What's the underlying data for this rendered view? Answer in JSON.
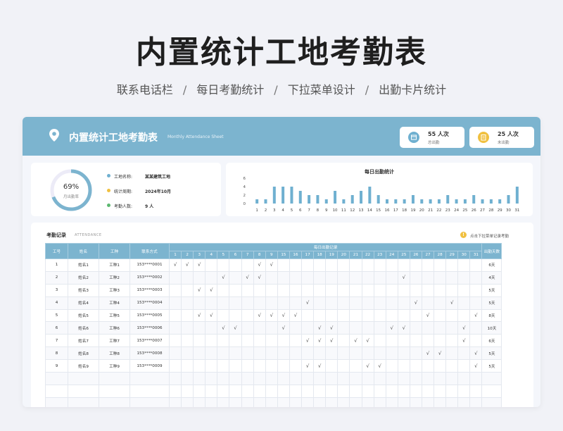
{
  "headline": "内置统计工地考勤表",
  "features": [
    "联系电话栏",
    "每日考勤统计",
    "下拉菜单设计",
    "出勤卡片统计"
  ],
  "feature_separator": "/",
  "sheet": {
    "title": "内置统计工地考勤表",
    "subtitle": "Monthly Attendance Sheet",
    "stats": [
      {
        "value": "55 人次",
        "label": "总出勤",
        "icon": "calendar-icon",
        "color": "#6fb0d0"
      },
      {
        "value": "25 人次",
        "label": "未出勤",
        "icon": "clipboard-icon",
        "color": "#f0c040"
      }
    ]
  },
  "summary": {
    "rate_value": "69%",
    "rate_label": "月出勤率",
    "rate_fraction": 0.69,
    "items": [
      {
        "key": "工地名称:",
        "value": "某某建筑工地",
        "color": "#6fb0d0"
      },
      {
        "key": "统计周期:",
        "value": "2024年10月",
        "color": "#f0c040"
      },
      {
        "key": "考勤人数:",
        "value": "9 人",
        "color": "#5cb870"
      }
    ]
  },
  "chart_data": {
    "type": "bar",
    "title": "每日出勤统计",
    "categories": [
      "1",
      "2",
      "3",
      "4",
      "5",
      "6",
      "7",
      "8",
      "9",
      "10",
      "11",
      "12",
      "13",
      "14",
      "15",
      "16",
      "17",
      "18",
      "19",
      "20",
      "21",
      "22",
      "23",
      "24",
      "25",
      "26",
      "27",
      "28",
      "29",
      "30",
      "31"
    ],
    "values": [
      1,
      1,
      4,
      4,
      4,
      3,
      2,
      2,
      1,
      3,
      1,
      2,
      3,
      4,
      2,
      1,
      1,
      1,
      2,
      1,
      1,
      1,
      2,
      1,
      1,
      2,
      1,
      1,
      1,
      2,
      4
    ],
    "yticks": [
      "0",
      "2",
      "4",
      "6"
    ],
    "ylim": [
      0,
      6
    ],
    "color": "#6fb0d0"
  },
  "records": {
    "title": "考勤记录",
    "subtitle": "ATTENDANCE",
    "hint_icon": "!",
    "hint": "点击下拉菜单记录考勤",
    "group_header": "每日出勤记录",
    "headers": {
      "id": "工号",
      "name": "姓名",
      "type": "工种",
      "phone": "联系方式",
      "total": "出勤天数"
    },
    "day_headers": [
      "1",
      "2",
      "3",
      "4",
      "5",
      "6",
      "7",
      "8",
      "9",
      "15",
      "16",
      "17",
      "18",
      "19",
      "20",
      "21",
      "22",
      "23",
      "24",
      "25",
      "26",
      "27",
      "28",
      "29",
      "30",
      "31"
    ],
    "mark_symbol": "√",
    "rows": [
      {
        "id": "1",
        "name": "姓名1",
        "type": "工种1",
        "phone": "153****0001",
        "days": [
          1,
          2,
          3,
          8,
          9
        ],
        "total": "6天"
      },
      {
        "id": "2",
        "name": "姓名2",
        "type": "工种2",
        "phone": "153****0002",
        "days": [
          5,
          7,
          8,
          20
        ],
        "total": "4天"
      },
      {
        "id": "3",
        "name": "姓名3",
        "type": "工种3",
        "phone": "153****0003",
        "days": [
          3,
          4
        ],
        "total": "5天"
      },
      {
        "id": "4",
        "name": "姓名4",
        "type": "工种4",
        "phone": "153****0004",
        "days": [
          12,
          21,
          24
        ],
        "total": "5天"
      },
      {
        "id": "5",
        "name": "姓名5",
        "type": "工种5",
        "phone": "153****0005",
        "days": [
          3,
          4,
          8,
          9,
          10,
          11,
          22,
          26
        ],
        "total": "8天"
      },
      {
        "id": "6",
        "name": "姓名6",
        "type": "工种6",
        "phone": "153****0006",
        "days": [
          5,
          6,
          10,
          13,
          14,
          19,
          20,
          25
        ],
        "total": "10天"
      },
      {
        "id": "7",
        "name": "姓名7",
        "type": "工种7",
        "phone": "153****0007",
        "days": [
          12,
          13,
          14,
          16,
          17,
          25
        ],
        "total": "6天"
      },
      {
        "id": "8",
        "name": "姓名8",
        "type": "工种8",
        "phone": "153****0008",
        "days": [
          22,
          23,
          26
        ],
        "total": "5天"
      },
      {
        "id": "9",
        "name": "姓名9",
        "type": "工种9",
        "phone": "153****0009",
        "days": [
          12,
          13,
          17,
          18,
          26
        ],
        "total": "5天"
      }
    ],
    "empty_rows": 3
  }
}
